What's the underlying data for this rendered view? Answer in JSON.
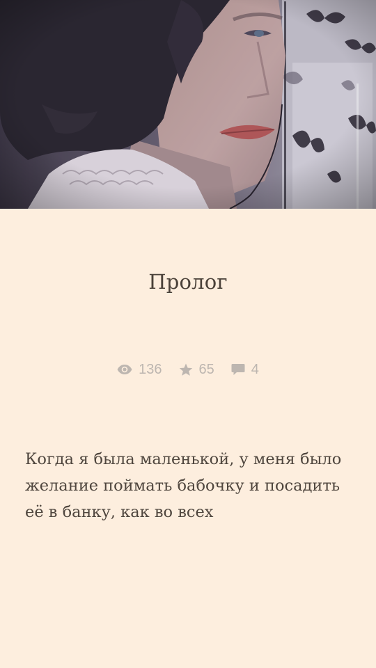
{
  "cover": {
    "icon": "cover-portrait-image",
    "colors": {
      "shadow": "#2f2a36",
      "skin": "#c2a39f",
      "lips": "#b85552",
      "background": "#8c8896"
    }
  },
  "chapter": {
    "title": "Пролог"
  },
  "stats": {
    "views": "136",
    "votes": "65",
    "comments": "4",
    "icons": {
      "views": "eye-icon",
      "votes": "star-icon",
      "comments": "comment-icon"
    },
    "color": "#bdb6b0"
  },
  "content": {
    "text": "Когда я была маленькой, у меня было желание поймать бабочку и посадить её в банку, как во всех"
  },
  "theme": {
    "background": "#fdeede",
    "text_color": "#4f463e"
  }
}
